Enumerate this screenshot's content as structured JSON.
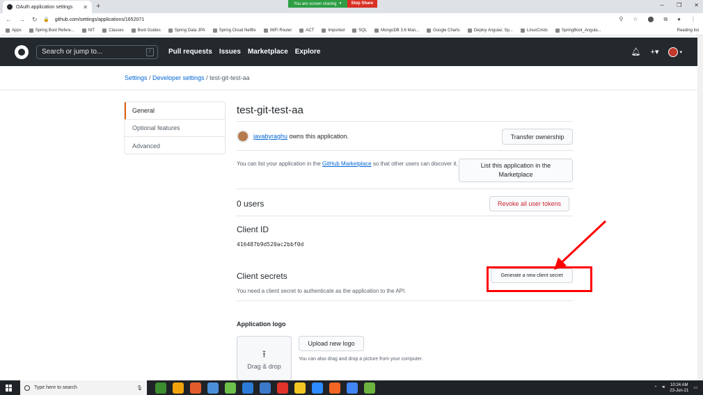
{
  "browser": {
    "tab_title": "OAuth application settings",
    "url": "github.com/settings/applications/1652071",
    "share_text": "You are screen sharing",
    "stop_share_label": "Stop Share",
    "bookmarks": [
      "Apps",
      "Spring Boot Refere...",
      "NIT",
      "Classes",
      "Boot Guides",
      "Spring Data JPA",
      "Spring Cloud Netflix",
      "WiFi Router",
      "ACT",
      "Imported",
      "SQL",
      "MongoDB 3.6 Man...",
      "Google Charts",
      "Deploy Angular, Sp...",
      "LinuxCmds",
      "SpringBoot_Angula..."
    ],
    "reading_list": "Reading list"
  },
  "github_header": {
    "search_placeholder": "Search or jump to...",
    "search_shortcut": "/",
    "nav": [
      "Pull requests",
      "Issues",
      "Marketplace",
      "Explore"
    ],
    "plus_label": "+▾"
  },
  "breadcrumb": {
    "settings": "Settings",
    "sep": " / ",
    "developer": "Developer settings",
    "current": "test-git-test-aa"
  },
  "sidebar": {
    "items": [
      "General",
      "Optional features",
      "Advanced"
    ]
  },
  "app": {
    "title": "test-git-test-aa",
    "owner_name": "javabyraghu",
    "owner_suffix": " owns this application.",
    "transfer_button": "Transfer ownership",
    "marketplace_text_1": "You can list your application in the ",
    "marketplace_link": "GitHub Marketplace",
    "marketplace_text_2": " so that other users can discover it.",
    "list_button": "List this application in the Marketplace",
    "users_heading": "0 users",
    "revoke_button": "Revoke all user tokens",
    "client_id_heading": "Client ID",
    "client_id_value": "416487b9d520ac2bbf0d",
    "client_secrets_heading": "Client secrets",
    "client_secrets_text": "You need a client secret to authenticate as the application to the API.",
    "generate_button": "Generate a new client secret",
    "logo_heading": "Application logo",
    "drag_drop": "Drag & drop",
    "upload_button": "Upload new logo",
    "upload_hint": "You can also drag and drop a picture from your computer."
  },
  "taskbar": {
    "search_placeholder": "Type here to search",
    "time": "10:24 AM",
    "date": "23-Jun-21",
    "app_colors": [
      "#3c8d2f",
      "#f0a30a",
      "#e25d2a",
      "#4a90d9",
      "#6cc04a",
      "#2b7bd6",
      "#3c7ac9",
      "#e0342b",
      "#f3c623",
      "#2d8cff",
      "#f26522",
      "#4285f4",
      "#6db33f"
    ]
  },
  "colors": {
    "github_header": "#24292e",
    "link": "#0366d6",
    "danger": "#cb2431",
    "annotation": "#ff0000"
  }
}
